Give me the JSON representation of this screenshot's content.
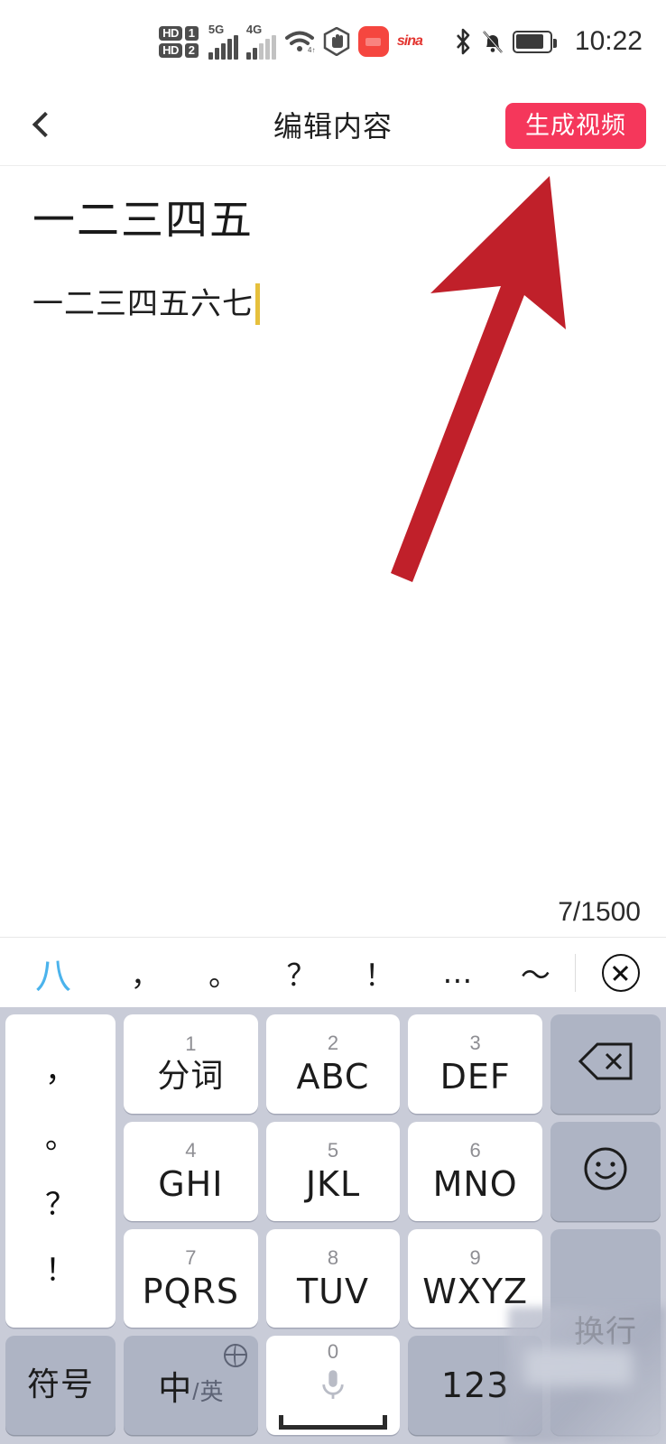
{
  "statusbar": {
    "hd_label": "HD",
    "sim1": "1",
    "sim2": "2",
    "net1": "5G",
    "net2": "4G",
    "wifi_icon": "wifi-icon",
    "hand_icon": "hand-icon",
    "app_icon": "red-app-icon",
    "sina_icon": "sina-icon",
    "bluetooth_icon": "bluetooth-icon",
    "silent_icon": "bell-muted-icon",
    "battery_icon": "battery-icon",
    "time": "10:22"
  },
  "navbar": {
    "back_icon": "chevron-left-icon",
    "title": "编辑内容",
    "action_label": "生成视频",
    "action_color": "#F5375B"
  },
  "editor": {
    "title_text": "一二三四五",
    "body_text": "一二三四五六七",
    "caret_color": "#E6C03C",
    "counter": "7/1500"
  },
  "annotation": {
    "arrow_icon": "red-arrow-up-right",
    "arrow_color": "#C0202A"
  },
  "keyboard": {
    "candidate_word": "八",
    "candidate_color": "#4BB3EC",
    "punctuation": [
      "，",
      "。",
      "？",
      "！",
      "…",
      "～"
    ],
    "close_icon": "close-circle-icon",
    "punct_column": [
      "，",
      "。",
      "？",
      "！"
    ],
    "keys": [
      {
        "num": "1",
        "label": "分词",
        "cn": true
      },
      {
        "num": "2",
        "label": "ABC",
        "cn": false
      },
      {
        "num": "3",
        "label": "DEF",
        "cn": false
      },
      {
        "num": "4",
        "label": "GHI",
        "cn": false
      },
      {
        "num": "5",
        "label": "JKL",
        "cn": false
      },
      {
        "num": "6",
        "label": "MNO",
        "cn": false
      },
      {
        "num": "7",
        "label": "PQRS",
        "cn": false
      },
      {
        "num": "8",
        "label": "TUV",
        "cn": false
      },
      {
        "num": "9",
        "label": "WXYZ",
        "cn": false
      }
    ],
    "backspace_icon": "backspace-icon",
    "emoji_icon": "smiley-icon",
    "enter_label": "换行",
    "symbol_label": "符号",
    "lang_cn": "中",
    "lang_slash": "/",
    "lang_en": "英",
    "globe_icon": "globe-icon",
    "space_num": "0",
    "mic_icon": "microphone-icon",
    "numeric_label": "123",
    "blurred_region": "obscured-overlay"
  }
}
